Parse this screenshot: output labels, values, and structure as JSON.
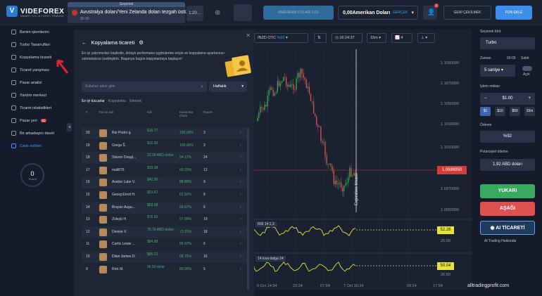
{
  "header": {
    "logo": "VIDEFOREX",
    "logo_sub": "BINARY OTC & FOREX TRADING",
    "asset_tab": {
      "selected_label": "Seçenek",
      "name": "Avustralya doları/Yeni Zelanda doları tezgah üstü",
      "payout": "$0.00"
    },
    "tab2_label": "1:20…",
    "amer_label": "AMERİKAN DOLARI 0,00",
    "balance": "0,00Amerikan Doları",
    "balance_tag": "GERÇEK",
    "notif_count": "1",
    "withdraw_label": "GERİ ÇEKİLMEK",
    "deposit_label": "FON EKLE"
  },
  "sidebar": {
    "items": [
      {
        "label": "Benim işlemlerim"
      },
      {
        "label": "Turbo Tasarrufları"
      },
      {
        "label": "Kopyalama ticareti"
      },
      {
        "label": "Ticaret yarışması"
      },
      {
        "label": "Pazar analizi"
      },
      {
        "label": "Yardım merkezi"
      },
      {
        "label": "Ticaret istatistikleri"
      },
      {
        "label": "Pazar yeri",
        "badge": "11"
      },
      {
        "label": "Bir arkadaşını davet"
      },
      {
        "label": "Canlı sohbet"
      }
    ],
    "trade_count": "0",
    "trade_label": "Ticaret"
  },
  "panel": {
    "title": "Kopyalama ticareti",
    "desc": "En iyi yatırımcıları keşfedin, detaylı performans içgörülerine erişin ve kopyalama ayarlarınızı zahmetsizce özelleştirin. Başarıya bugün kopyalamaya başlayın!",
    "search_placeholder": "Kullanıcı adını girin",
    "period": "Haftalık",
    "tabs": [
      "En iyi tüccarlar",
      "Kopyalama",
      "İzlemek"
    ],
    "columns": [
      "#",
      "Tüccar adı",
      "Kâr",
      "Kazanma Oranı",
      "Ticaret"
    ],
    "rows": [
      {
        "rank": "20",
        "name": "Rui Pedro g.",
        "profit": "$16.77",
        "rate": "100,00%",
        "trades": "3"
      },
      {
        "rank": "19",
        "name": "Grega Š.",
        "profit": "$16.96",
        "rate": "100,00%",
        "trades": "3"
      },
      {
        "rank": "18",
        "name": "Steven Dougl...",
        "profit": "22,99 ABD doları",
        "rate": "54.17%",
        "trades": "24"
      },
      {
        "rank": "17",
        "name": "mali876",
        "profit": "$39.38",
        "rate": "69.23%",
        "trades": "13"
      },
      {
        "rank": "16",
        "name": "Avalon Luke V.",
        "profit": "$42.00",
        "rate": "88.89%",
        "trades": "9"
      },
      {
        "rank": "15",
        "name": "Georg Ernst H.",
        "profit": "$53.62",
        "rate": "62.50%",
        "trades": "8"
      },
      {
        "rank": "14",
        "name": "Brayan Augu...",
        "profit": "$68.08",
        "rate": "66.67%",
        "trades": "6"
      },
      {
        "rank": "13",
        "name": "Züleyb H.",
        "profit": "$76.65",
        "rate": "57.89%",
        "trades": "19"
      },
      {
        "rank": "12",
        "name": "Denise V.",
        "profit": "76,76 ABD doları",
        "rate": "72.22%",
        "trades": "18"
      },
      {
        "rank": "11",
        "name": "Curtis Lewis ...",
        "profit": "$84.88",
        "rate": "66.67%",
        "trades": "6"
      },
      {
        "rank": "10",
        "name": "Dilan James D.",
        "profit": "$85.23",
        "rate": "68.75%",
        "trades": "16"
      },
      {
        "rank": "9",
        "name": "Rick M.",
        "profit": "96,50 dolar",
        "rate": "80.00%",
        "trades": "5"
      }
    ]
  },
  "chart": {
    "pair": "/NZD OTC",
    "pair_pct": "%92",
    "clock": "16:24:37",
    "interval": "15m",
    "ind_count": "4",
    "current_price": "1,0986950",
    "prices": [
      "1.1090000",
      "1.1070000",
      "1.1050000",
      "1.1030000",
      "1.1010000",
      "1.0970000",
      "1.0950000"
    ],
    "vline_label": "Expiration time",
    "rsi_label": "RSI 14 1,3",
    "rsi_value": "52.28",
    "rsi_lo": "25.00",
    "osc_label": "14 kısa dalga 14",
    "osc_value": "50.04",
    "osc_lo": "26.50",
    "x_labels": [
      "6 Oct 14:54",
      "23:24",
      "07:54",
      "7 Oct 16:24",
      "09:24",
      "17:54"
    ]
  },
  "order": {
    "type_label": "Seçenek türü",
    "type": "Turbo",
    "time_label": "Zaman",
    "time_hint": "00:05",
    "fixed_label": "Sabit",
    "time": "5 saniye",
    "toggle_label": "Açık",
    "amount_label": "İşlem miktarı",
    "amount": "$1.00",
    "quick": [
      "$1",
      "$10",
      "$50",
      "10m"
    ],
    "payout_label": "Ödeme",
    "payout": "%92",
    "potential_label": "Potansiyel ödeme",
    "potential": "1,92 ABD doları",
    "up": "YUKARI",
    "down": "AŞAĞI",
    "ai": "AI TİCARETİ",
    "ai_about": "AI Trading Hakkında"
  },
  "watermark": "alltradingprofit.com",
  "colors": {
    "up": "#3aa85e",
    "down": "#e0504f",
    "accent": "#3d8ee8"
  }
}
